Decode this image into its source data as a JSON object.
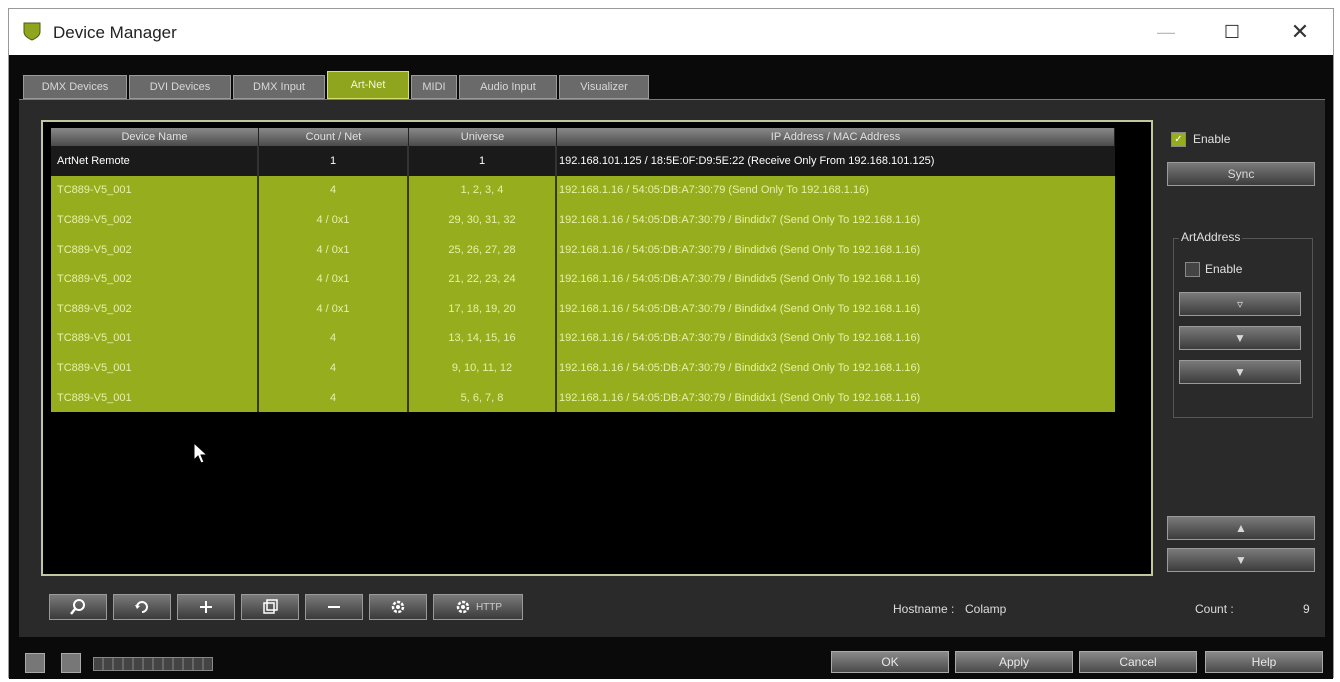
{
  "window": {
    "title": "Device Manager"
  },
  "tabs": [
    {
      "label": "DMX Devices"
    },
    {
      "label": "DVI Devices"
    },
    {
      "label": "DMX Input"
    },
    {
      "label": "Art-Net",
      "active": true
    },
    {
      "label": "MIDI"
    },
    {
      "label": "Audio Input"
    },
    {
      "label": "Visualizer"
    }
  ],
  "table": {
    "headers": [
      "Device Name",
      "Count / Net",
      "Universe",
      "IP Address / MAC Address"
    ],
    "rows": [
      [
        "ArtNet Remote",
        "1",
        "1",
        "192.168.101.125 / 18:5E:0F:D9:5E:22 (Receive Only From 192.168.101.125)"
      ],
      [
        "TC889-V5_001",
        "4",
        "1, 2, 3, 4",
        "192.168.1.16 / 54:05:DB:A7:30:79 (Send Only To 192.168.1.16)"
      ],
      [
        "TC889-V5_002",
        "4 / 0x1",
        "29, 30, 31, 32",
        "192.168.1.16 / 54:05:DB:A7:30:79 / Bindidx7 (Send Only To 192.168.1.16)"
      ],
      [
        "TC889-V5_002",
        "4 / 0x1",
        "25, 26, 27, 28",
        "192.168.1.16 / 54:05:DB:A7:30:79 / Bindidx6 (Send Only To 192.168.1.16)"
      ],
      [
        "TC889-V5_002",
        "4 / 0x1",
        "21, 22, 23, 24",
        "192.168.1.16 / 54:05:DB:A7:30:79 / Bindidx5 (Send Only To 192.168.1.16)"
      ],
      [
        "TC889-V5_002",
        "4 / 0x1",
        "17, 18, 19, 20",
        "192.168.1.16 / 54:05:DB:A7:30:79 / Bindidx4 (Send Only To 192.168.1.16)"
      ],
      [
        "TC889-V5_001",
        "4",
        "13, 14, 15, 16",
        "192.168.1.16 / 54:05:DB:A7:30:79 / Bindidx3 (Send Only To 192.168.1.16)"
      ],
      [
        "TC889-V5_001",
        "4",
        "9, 10, 11, 12",
        "192.168.1.16 / 54:05:DB:A7:30:79 / Bindidx2 (Send Only To 192.168.1.16)"
      ],
      [
        "TC889-V5_001",
        "4",
        "5, 6, 7, 8",
        "192.168.1.16 / 54:05:DB:A7:30:79 / Bindidx1 (Send Only To 192.168.1.16)"
      ]
    ]
  },
  "right_panel": {
    "enable_label": "Enable",
    "sync_label": "Sync",
    "artaddress_label": "ArtAddress",
    "artaddress_enable_label": "Enable"
  },
  "status": {
    "hostname_label": "Hostname :",
    "hostname_value": "Colamp",
    "count_label": "Count :",
    "count_value": "9"
  },
  "toolbar": {
    "http_label": "HTTP"
  },
  "dialog_buttons": {
    "ok": "OK",
    "apply": "Apply",
    "cancel": "Cancel",
    "help": "Help"
  },
  "colors": {
    "selection_green": "#96ad1d",
    "accent_tab": "#8fa51d"
  }
}
